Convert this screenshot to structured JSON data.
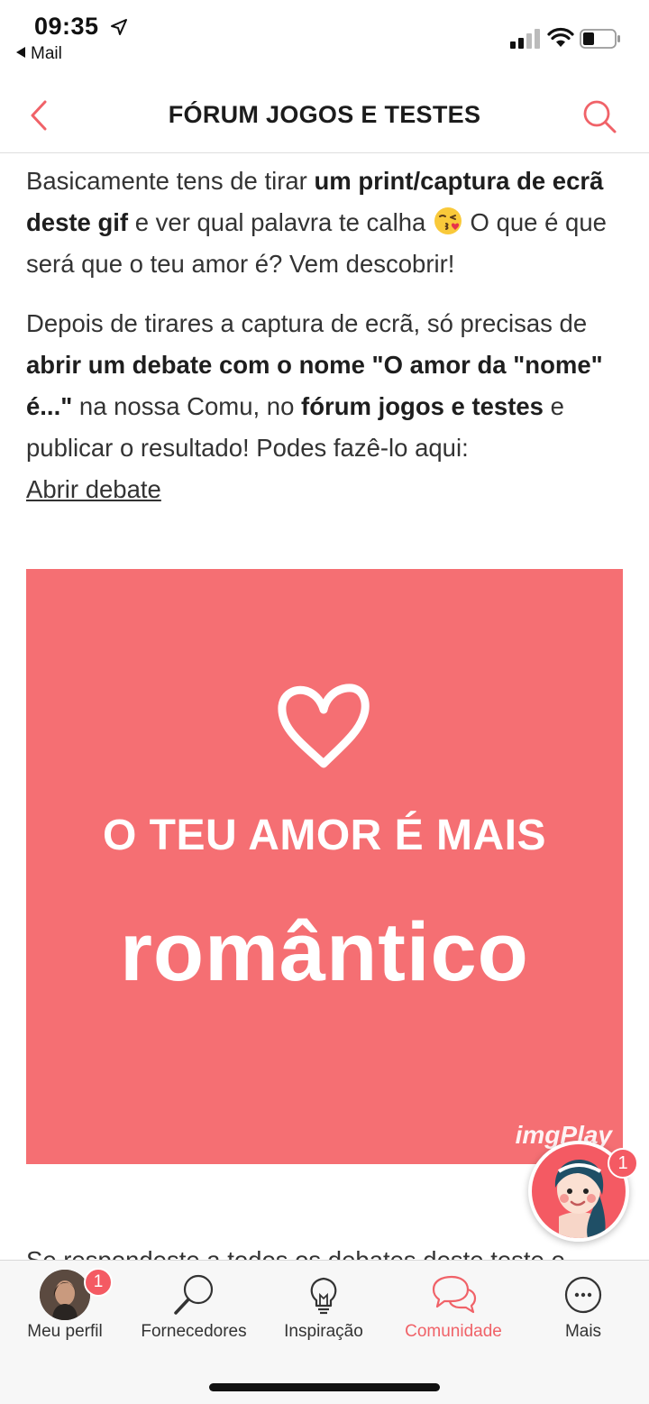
{
  "status_bar": {
    "time": "09:35",
    "back_app": "Mail",
    "icons": [
      "location-arrow-icon",
      "signal-icon",
      "wifi-icon",
      "battery-icon"
    ]
  },
  "nav": {
    "title": "FÓRUM JOGOS E TESTES",
    "back_icon": "chevron-left-icon",
    "search_icon": "search-icon",
    "accent_color": "#f06268"
  },
  "content": {
    "para1": {
      "t1": "Basicamente tens de tirar ",
      "b1": "um print/captura de ecrã deste gif",
      "t2": " e ver qual palavra te calha ",
      "emoji": "face-blowing-kiss-emoji",
      "t3": " O que é que será que o teu amor é? Vem descobrir!"
    },
    "para2": {
      "t1": "Depois de tirares a captura de ecrã, só precisas de ",
      "b1": "abrir um debate com o nome \"O amor da \"nome\" é...\"",
      "t2": " na nossa Comu, no ",
      "b2": "fórum jogos e testes",
      "t3": " e publicar o resultado! Podes fazê-lo aqui: ",
      "link": "Abrir debate"
    },
    "gif": {
      "line1": "O TEU AMOR É MAIS",
      "line2": "romântico",
      "watermark": "imgPlay",
      "bg_color": "#f56f73"
    },
    "cut_text": "Se respondeste a todos os debates deste teste o"
  },
  "floating_avatar": {
    "badge": "1"
  },
  "tab_bar": {
    "items": [
      {
        "label": "Meu perfil",
        "icon": "profile-avatar",
        "badge": "1"
      },
      {
        "label": "Fornecedores",
        "icon": "magnifier-icon"
      },
      {
        "label": "Inspiração",
        "icon": "lightbulb-icon"
      },
      {
        "label": "Comunidade",
        "icon": "chat-bubbles-icon",
        "active": true
      },
      {
        "label": "Mais",
        "icon": "more-dots-icon"
      }
    ]
  }
}
